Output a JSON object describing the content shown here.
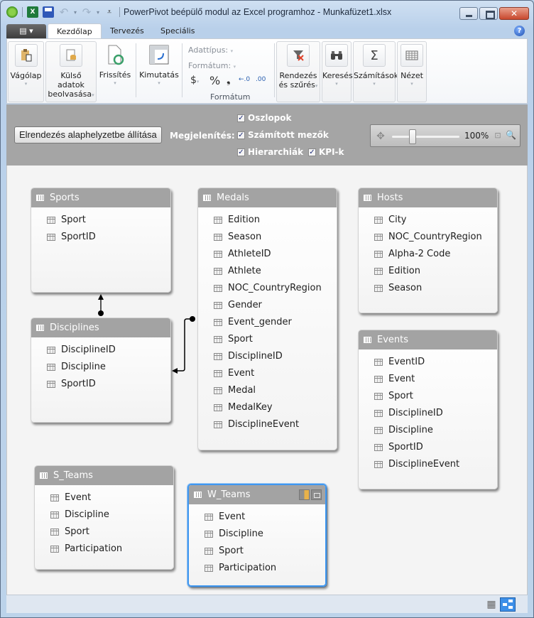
{
  "window": {
    "title": "PowerPivot beépülő modul az Excel programhoz - Munkafüzet1.xlsx",
    "close_glyph": "✕"
  },
  "ribbon": {
    "tabs": [
      {
        "label": "Kezdőlap",
        "active": true
      },
      {
        "label": "Tervezés",
        "active": false
      },
      {
        "label": "Speciális",
        "active": false
      }
    ],
    "file_menu_glyph": "▤ ▾",
    "help_glyph": "?",
    "buttons": {
      "clipboard": "Vágólap",
      "external_data_line1": "Külső adatok",
      "external_data_line2": "beolvasása",
      "refresh": "Frissítés",
      "pivot": "Kimutatás",
      "sort_filter_line1": "Rendezés",
      "sort_filter_line2": "és szűrés",
      "find": "Keresés",
      "calculations": "Számítások",
      "view": "Nézet"
    },
    "format_group": {
      "data_type_label": "Adattípus:",
      "format_label": "Formátum:",
      "currency_symbol": "$",
      "percent_symbol": "%",
      "comma_symbol": "❟",
      "inc_decimal": "←.0",
      "dec_decimal": ".00",
      "group_label": "Formátum"
    },
    "icons": {
      "sum_glyph": "Σ",
      "find_glyph": "🔭",
      "dropdown_glyph": "▾"
    }
  },
  "diagram_toolbar": {
    "reset_layout_label": "Elrendezés alaphelyzetbe állítása",
    "show_label": "Megjelenítés:",
    "checkboxes": [
      {
        "label": "Oszlopok",
        "checked": true
      },
      {
        "label": "Számított mezők",
        "checked": true
      },
      {
        "label": "Hierarchiák",
        "checked": true
      },
      {
        "label": "KPI-k",
        "checked": true
      }
    ],
    "check_glyph": "✓",
    "zoom_value": "100%",
    "zoom_fraction": 0.3,
    "pan_glyph": "✥",
    "fit_glyph": "⊡",
    "zoom_select_glyph": "🔍"
  },
  "tables": [
    {
      "name": "Sports",
      "columns": [
        "Sport",
        "SportID"
      ]
    },
    {
      "name": "Disciplines",
      "columns": [
        "DisciplineID",
        "Discipline",
        "SportID"
      ]
    },
    {
      "name": "Medals",
      "columns": [
        "Edition",
        "Season",
        "AthleteID",
        "Athlete",
        "NOC_CountryRegion",
        "Gender",
        "Event_gender",
        "Sport",
        "DisciplineID",
        "Event",
        "Medal",
        "MedalKey",
        "DisciplineEvent"
      ]
    },
    {
      "name": "Hosts",
      "columns": [
        "City",
        "NOC_CountryRegion",
        "Alpha-2 Code",
        "Edition",
        "Season"
      ]
    },
    {
      "name": "Events",
      "columns": [
        "EventID",
        "Event",
        "Sport",
        "DisciplineID",
        "Discipline",
        "SportID",
        "DisciplineEvent"
      ]
    },
    {
      "name": "S_Teams",
      "columns": [
        "Event",
        "Discipline",
        "Sport",
        "Participation"
      ]
    },
    {
      "name": "W_Teams",
      "columns": [
        "Event",
        "Discipline",
        "Sport",
        "Participation"
      ],
      "selected": true
    }
  ],
  "relationships": [
    {
      "from": "Disciplines",
      "to": "Sports"
    },
    {
      "from": "Medals",
      "to": "Disciplines"
    }
  ],
  "statusbar": {
    "grid_view_glyph": "▦"
  }
}
